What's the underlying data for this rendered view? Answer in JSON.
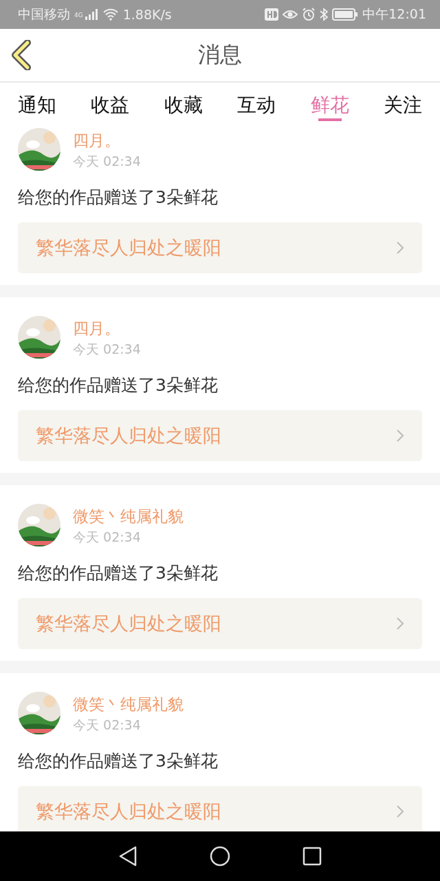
{
  "status_bar": {
    "carrier": "中国移动",
    "network": "4G",
    "speed": "1.88K/s",
    "time": "中午12:01"
  },
  "header": {
    "title": "消息"
  },
  "tabs": [
    {
      "label": "通知",
      "selected": false
    },
    {
      "label": "收益",
      "selected": false
    },
    {
      "label": "收藏",
      "selected": false
    },
    {
      "label": "互动",
      "selected": false
    },
    {
      "label": "鲜花",
      "selected": true
    },
    {
      "label": "关注",
      "selected": false
    }
  ],
  "messages": [
    {
      "name": "四月。",
      "time": "今天 02:34",
      "text": "给您的作品赠送了3朵鲜花",
      "work": "繁华落尽人归处之暖阳"
    },
    {
      "name": "四月。",
      "time": "今天 02:34",
      "text": "给您的作品赠送了3朵鲜花",
      "work": "繁华落尽人归处之暖阳"
    },
    {
      "name": "微笑丶纯属礼貌",
      "time": "今天 02:34",
      "text": "给您的作品赠送了3朵鲜花",
      "work": "繁华落尽人归处之暖阳"
    },
    {
      "name": "微笑丶纯属礼貌",
      "time": "今天 02:34",
      "text": "给您的作品赠送了3朵鲜花",
      "work": "繁华落尽人归处之暖阳"
    }
  ]
}
